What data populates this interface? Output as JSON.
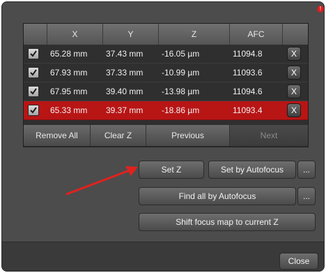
{
  "table": {
    "headers": {
      "x": "X",
      "y": "Y",
      "z": "Z",
      "afc": "AFC"
    },
    "rows": [
      {
        "x": "65.28 mm",
        "y": "37.43 mm",
        "z": "-16.05 µm",
        "afc": "11094.8",
        "remove": "X",
        "checked": true,
        "selected": false
      },
      {
        "x": "67.93 mm",
        "y": "37.33 mm",
        "z": "-10.99 µm",
        "afc": "11093.6",
        "remove": "X",
        "checked": true,
        "selected": false
      },
      {
        "x": "67.95 mm",
        "y": "39.40 mm",
        "z": "-13.98 µm",
        "afc": "11094.6",
        "remove": "X",
        "checked": true,
        "selected": false
      },
      {
        "x": "65.33 mm",
        "y": "39.37 mm",
        "z": "-18.86 µm",
        "afc": "11093.4",
        "remove": "X",
        "checked": true,
        "selected": true
      }
    ],
    "buttons": {
      "remove_all": "Remove All",
      "clear_z": "Clear Z",
      "previous": "Previous",
      "next": "Next"
    }
  },
  "actions": {
    "set_z": "Set Z",
    "set_by_autofocus": "Set by Autofocus",
    "more1": "...",
    "find_all": "Find all by Autofocus",
    "more2": "...",
    "shift_focus": "Shift focus map to current Z"
  },
  "footer": {
    "close": "Close"
  },
  "notification": "!",
  "colors": {
    "panel": "#4c4c4c",
    "selected_row": "#b81515",
    "arrow": "#e0221f",
    "notification": "#d42020"
  }
}
